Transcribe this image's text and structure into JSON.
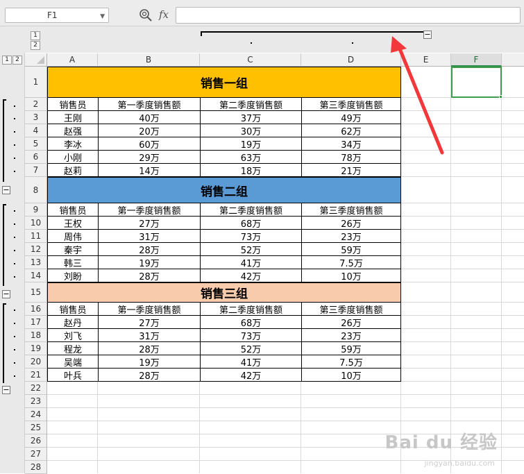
{
  "formula_bar": {
    "name_box": "F1",
    "fx_label": "fx",
    "formula_value": ""
  },
  "outline": {
    "col_levels": [
      "1",
      "2"
    ],
    "row_levels": [
      "1",
      "2"
    ],
    "collapse_symbol": "−"
  },
  "columns": [
    "A",
    "B",
    "C",
    "D",
    "E",
    "F"
  ],
  "selected_column": "F",
  "rows": [
    "1",
    "2",
    "3",
    "4",
    "5",
    "6",
    "7",
    "8",
    "9",
    "10",
    "11",
    "12",
    "13",
    "14",
    "15",
    "16",
    "17",
    "18",
    "19",
    "20",
    "21",
    "22",
    "23",
    "24",
    "25",
    "26",
    "27",
    "28"
  ],
  "colors": {
    "group1": "#FFC000",
    "group2": "#5B9BD5",
    "group3": "#F8CBAD",
    "selection": "#3f9b4e",
    "arrow": "#F2383A"
  },
  "table": {
    "headers": [
      "销售员",
      "第一季度销售额",
      "第二季度销售额",
      "第三季度销售额"
    ],
    "groups": [
      {
        "title": "销售一组",
        "rows": [
          [
            "王刚",
            "40万",
            "37万",
            "49万"
          ],
          [
            "赵强",
            "20万",
            "30万",
            "62万"
          ],
          [
            "李冰",
            "60万",
            "19万",
            "34万"
          ],
          [
            "小刚",
            "29万",
            "63万",
            "78万"
          ],
          [
            "赵莉",
            "14万",
            "18万",
            "21万"
          ]
        ]
      },
      {
        "title": "销售二组",
        "rows": [
          [
            "王权",
            "27万",
            "68万",
            "26万"
          ],
          [
            "周伟",
            "31万",
            "73万",
            "23万"
          ],
          [
            "秦宇",
            "28万",
            "52万",
            "59万"
          ],
          [
            "韩三",
            "19万",
            "41万",
            "7.5万"
          ],
          [
            "刘盼",
            "28万",
            "42万",
            "10万"
          ]
        ]
      },
      {
        "title": "销售三组",
        "rows": [
          [
            "赵丹",
            "27万",
            "68万",
            "26万"
          ],
          [
            "刘飞",
            "31万",
            "73万",
            "23万"
          ],
          [
            "程龙",
            "28万",
            "52万",
            "59万"
          ],
          [
            "吴端",
            "19万",
            "41万",
            "7.5万"
          ],
          [
            "叶兵",
            "28万",
            "42万",
            "10万"
          ]
        ]
      }
    ]
  },
  "watermark": {
    "main": "Bai du 经验",
    "sub": "jingyan.baidu.com"
  }
}
